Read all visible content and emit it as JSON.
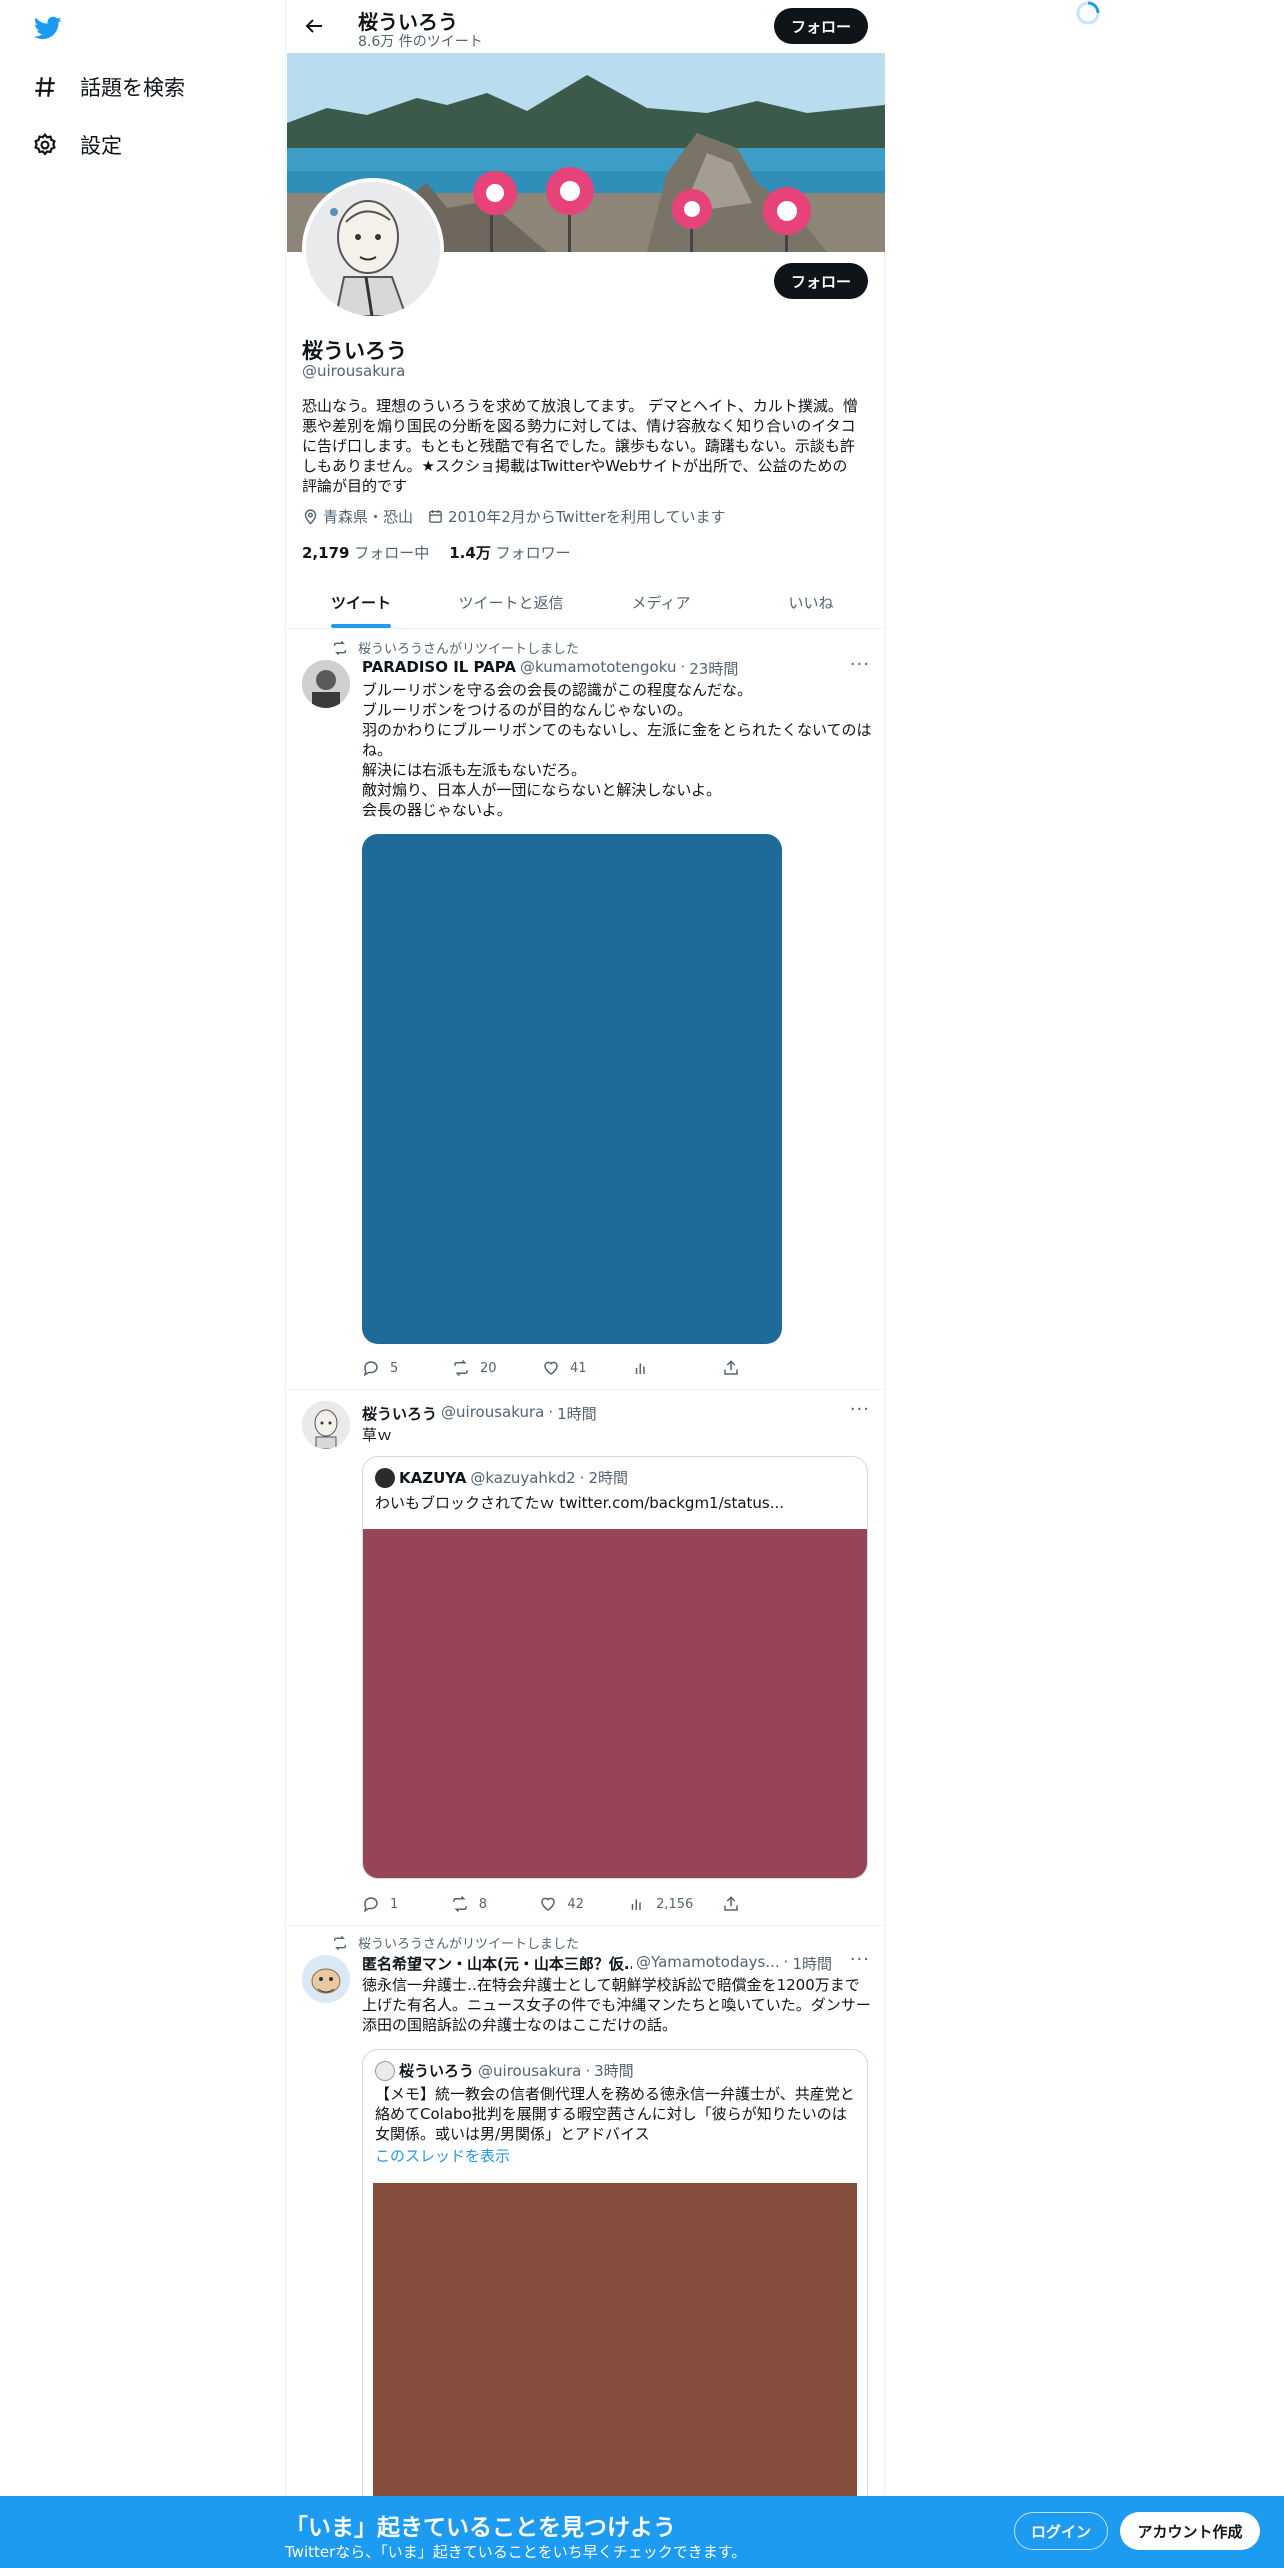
{
  "nav": {
    "items": [
      {
        "label": "話題を検索",
        "icon": "hashtag-icon"
      },
      {
        "label": "設定",
        "icon": "gear-icon"
      }
    ]
  },
  "header": {
    "name": "桜ういろう",
    "tweet_count": "8.6万 件のツイート",
    "follow_label": "フォロー"
  },
  "profile": {
    "name": "桜ういろう",
    "handle": "@uirousakura",
    "follow_label": "フォロー",
    "bio": "恐山なう。理想のういろうを求めて放浪してます。 デマとヘイト、カルト撲滅。憎悪や差別を煽り国民の分断を図る勢力に対しては、情け容赦なく知り合いのイタコに告げ口します。もともと残酷で有名でした。譲歩もない。躊躇もない。示談も許しもありません。★スクショ掲載はTwitterやWebサイトが出所で、公益のための評論が目的です",
    "location": "青森県・恐山",
    "joined": "2010年2月からTwitterを利用しています",
    "following_count": "2,179",
    "following_label": "フォロー中",
    "followers_count": "1.4万",
    "followers_label": "フォロワー"
  },
  "tabs": [
    "ツイート",
    "ツイートと返信",
    "メディア",
    "いいね"
  ],
  "tweets": [
    {
      "retweet_note": "桜ういろうさんがリツイートしました",
      "name": "PARADISO IL PAPA",
      "handle": "@kumamototengoku",
      "time": "23時間",
      "text": "ブルーリボンを守る会の会長の認識がこの程度なんだな。\nブルーリボンをつけるのが目的なんじゃないの。\n羽のかわりにブルーリボンてのもないし、左派に金をとられたくないてのはね。\n解決には右派も左派もないだろ。\n敵対煽り、日本人が一団にならないと解決しないよ。\n会長の器じゃないよ。",
      "media_color": "#1e6a99",
      "replies": "5",
      "retweets": "20",
      "likes": "41",
      "views": ""
    },
    {
      "name": "桜ういろう",
      "handle": "@uirousakura",
      "time": "1時間",
      "text": "草ｗ",
      "quote": {
        "name": "KAZUYA",
        "handle": "@kazuyahkd2",
        "time": "2時間",
        "text": "わいもブロックされてたｗ  twitter.com/backgm1/status...",
        "media_color": "#974457"
      },
      "replies": "1",
      "retweets": "8",
      "likes": "42",
      "views": "2,156"
    },
    {
      "retweet_note": "桜ういろうさんがリツイートしました",
      "name": "匿名希望マン・山本(元・山本三郎？仮...",
      "handle": "@Yamamotodays...",
      "time": "1時間",
      "text": "徳永信一弁護士‥在特会弁護士として朝鮮学校訴訟で賠償金を1200万まで上げた有名人。ニュース女子の件でも沖縄マンたちと喚いていた。ダンサー添田の国賠訴訟の弁護士なのはここだけの話。",
      "quote": {
        "name": "桜ういろう",
        "handle": "@uirousakura",
        "time": "3時間",
        "text": "【メモ】統一教会の信者側代理人を務める徳永信一弁護士が、共産党と絡めてColabo批判を展開する暇空茜さんに対し「彼らが知りたいのは女関係。或いは男/男関係」とアドバイス",
        "show_thread": "このスレッドを表示",
        "media_color": "#874d3c"
      }
    }
  ],
  "bottom_bar": {
    "title": "「いま」起きていることを見つけよう",
    "subtitle": "Twitterなら、「いま」起きていることをいち早くチェックできます。",
    "login": "ログイン",
    "signup": "アカウント作成"
  },
  "colors": {
    "accent": "#1d9bf0",
    "text": "#0f1419",
    "muted": "#536471"
  }
}
